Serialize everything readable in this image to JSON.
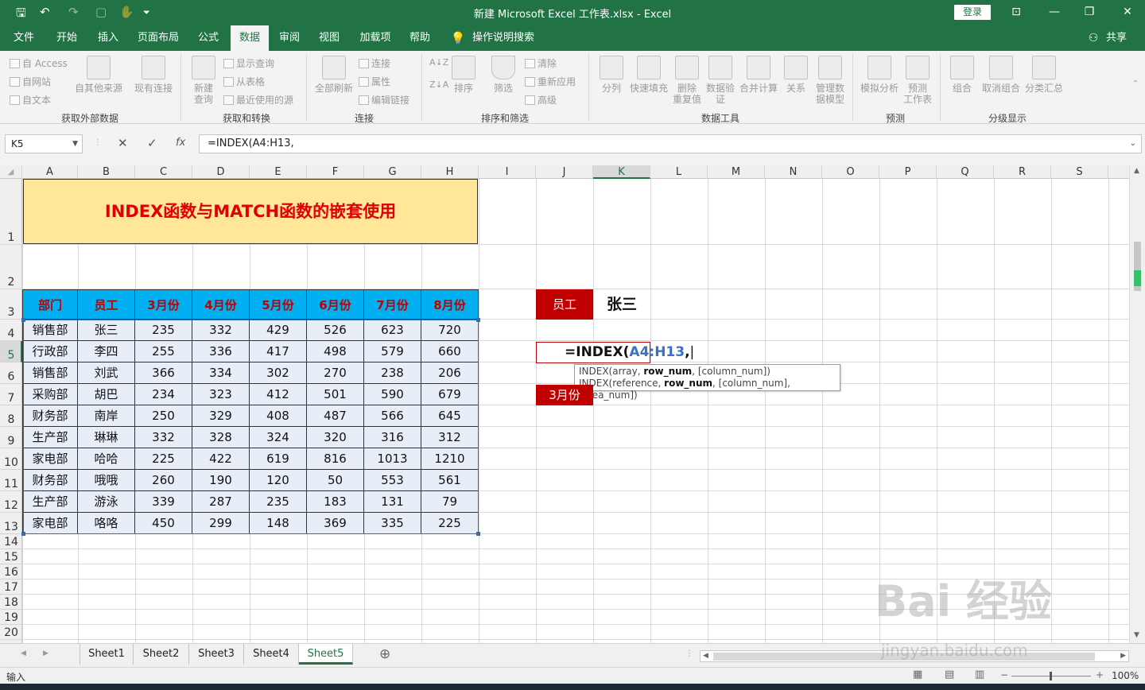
{
  "titlebar": {
    "title": "新建 Microsoft Excel 工作表.xlsx  -  Excel",
    "login": "登录"
  },
  "menu": {
    "tabs": [
      "文件",
      "开始",
      "插入",
      "页面布局",
      "公式",
      "数据",
      "审阅",
      "视图",
      "加载项",
      "帮助"
    ],
    "active": "数据",
    "search": "操作说明搜索",
    "share": "共享"
  },
  "ribbon": {
    "external": {
      "items": [
        "自 Access",
        "自网站",
        "自文本"
      ],
      "big": "自其他来源",
      "big2": "现有连接",
      "group": "获取外部数据"
    },
    "transform": {
      "big": "新建\n查询",
      "items": [
        "显示查询",
        "从表格",
        "最近使用的源"
      ],
      "group": "获取和转换"
    },
    "connections": {
      "big": "全部刷新",
      "items": [
        "连接",
        "属性",
        "编辑链接"
      ],
      "group": "连接"
    },
    "sortfilter": {
      "big1": "排序",
      "big2": "筛选",
      "items": [
        "清除",
        "重新应用",
        "高级"
      ],
      "group": "排序和筛选"
    },
    "tools": {
      "items": [
        "分列",
        "快速填充",
        "删除\n重复值",
        "数据验\n证",
        "合并计算",
        "关系",
        "管理数\n据模型"
      ],
      "group": "数据工具"
    },
    "forecast": {
      "items": [
        "模拟分析",
        "预测\n工作表"
      ],
      "group": "预测"
    },
    "outline": {
      "items": [
        "组合",
        "取消组合",
        "分类汇总"
      ],
      "group": "分级显示"
    }
  },
  "formula_bar": {
    "namebox": "K5",
    "cancel": "✕",
    "confirm": "✓",
    "fx": "fx",
    "value": "=INDEX(A4:H13,"
  },
  "columns": [
    "A",
    "B",
    "C",
    "D",
    "E",
    "F",
    "G",
    "H",
    "I",
    "J",
    "K",
    "L",
    "M",
    "N",
    "O",
    "P",
    "Q",
    "R",
    "S"
  ],
  "rows": [
    "1",
    "2",
    "3",
    "4",
    "5",
    "6",
    "7",
    "8",
    "9",
    "10",
    "11",
    "12",
    "13",
    "14",
    "15",
    "16",
    "17",
    "18",
    "19",
    "20"
  ],
  "sheet": {
    "title": "INDEX函数与MATCH函数的嵌套使用",
    "headers": [
      "部门",
      "员工",
      "3月份",
      "4月份",
      "5月份",
      "6月份",
      "7月份",
      "8月份"
    ],
    "rows": [
      [
        "销售部",
        "张三",
        "235",
        "332",
        "429",
        "526",
        "623",
        "720"
      ],
      [
        "行政部",
        "李四",
        "255",
        "336",
        "417",
        "498",
        "579",
        "660"
      ],
      [
        "销售部",
        "刘武",
        "366",
        "334",
        "302",
        "270",
        "238",
        "206"
      ],
      [
        "采购部",
        "胡巴",
        "234",
        "323",
        "412",
        "501",
        "590",
        "679"
      ],
      [
        "财务部",
        "南岸",
        "250",
        "329",
        "408",
        "487",
        "566",
        "645"
      ],
      [
        "生产部",
        "琳琳",
        "332",
        "328",
        "324",
        "320",
        "316",
        "312"
      ],
      [
        "家电部",
        "哈哈",
        "225",
        "422",
        "619",
        "816",
        "1013",
        "1210"
      ],
      [
        "财务部",
        "哦哦",
        "260",
        "190",
        "120",
        "50",
        "553",
        "561"
      ],
      [
        "生产部",
        "游泳",
        "339",
        "287",
        "235",
        "183",
        "131",
        "79"
      ],
      [
        "家电部",
        "咯咯",
        "450",
        "299",
        "148",
        "369",
        "335",
        "225"
      ]
    ],
    "lookup_label": "员工",
    "lookup_value": "张三",
    "month_label": "3月份",
    "editing": {
      "prefix": "=INDEX(",
      "ref": "A4:H13",
      "suffix": ","
    },
    "tooltip": {
      "line1_a": "INDEX(array, ",
      "line1_b": "row_num",
      "line1_c": ", [column_num])",
      "line2_a": "INDEX(reference, ",
      "line2_b": "row_num",
      "line2_c": ", [column_num], [area_num])"
    }
  },
  "sheet_tabs": [
    "Sheet1",
    "Sheet2",
    "Sheet3",
    "Sheet4",
    "Sheet5"
  ],
  "active_sheet": "Sheet5",
  "status": {
    "mode": "输入",
    "zoom": "100%"
  },
  "watermark": {
    "logo": "Bai 经验",
    "url": "jingyan.baidu.com"
  },
  "colors": {
    "excel_green": "#217346",
    "title_fill": "#ffe699",
    "header_fill": "#00b0f0",
    "label_fill": "#c00000"
  }
}
